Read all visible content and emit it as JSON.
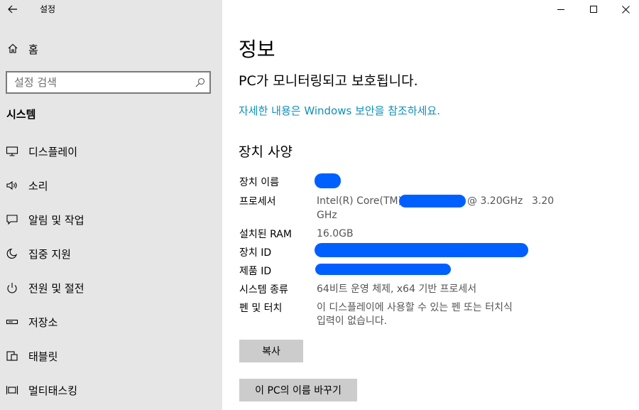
{
  "window": {
    "app_title": "설정",
    "controls": {
      "minimize": "minimize-icon",
      "maximize": "maximize-icon",
      "close": "close-icon"
    }
  },
  "sidebar": {
    "home_label": "홈",
    "search_placeholder": "설정 검색",
    "section_title": "시스템",
    "items": [
      {
        "label": "디스플레이",
        "icon": "monitor-icon"
      },
      {
        "label": "소리",
        "icon": "speaker-icon"
      },
      {
        "label": "알림 및 작업",
        "icon": "notification-icon"
      },
      {
        "label": "집중 지원",
        "icon": "moon-icon"
      },
      {
        "label": "전원 및 절전",
        "icon": "power-icon"
      },
      {
        "label": "저장소",
        "icon": "storage-icon"
      },
      {
        "label": "태블릿",
        "icon": "tablet-icon"
      },
      {
        "label": "멀티태스킹",
        "icon": "multitasking-icon"
      }
    ]
  },
  "main": {
    "title": "정보",
    "status": "PC가 모니터링되고 보호됩니다.",
    "security_link": "자세한 내용은 Windows 보안을 참조하세요.",
    "specs_title": "장치 사양",
    "specs": {
      "device_name_label": "장치 이름",
      "processor_label": "프로세서",
      "processor_prefix": "Intel(R) Core(TM)",
      "processor_suffix": "@ 3.20GHz",
      "processor_speed": "3.20",
      "processor_unit": "GHz",
      "ram_label": "설치된 RAM",
      "ram_value": "16.0GB",
      "device_id_label": "장치 ID",
      "product_id_label": "제품 ID",
      "system_type_label": "시스템 종류",
      "system_type_value": "64비트 운영 체제, x64 기반 프로세서",
      "pen_touch_label": "펜 및 터치",
      "pen_touch_line1": "이 디스플레이에 사용할 수 있는 펜 또는 터치식",
      "pen_touch_line2": "입력이 없습니다."
    },
    "copy_button": "복사",
    "rename_button": "이 PC의 이름 바꾸기",
    "redaction_color": "#0060ff",
    "link_color": "#0f8fb8"
  }
}
